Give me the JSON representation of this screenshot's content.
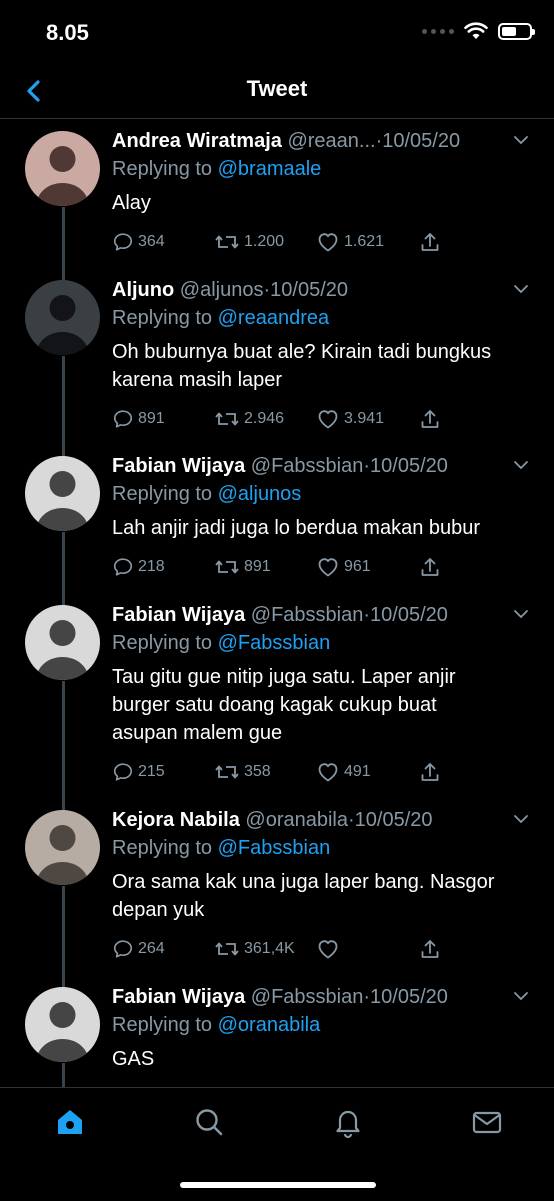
{
  "status_bar": {
    "time": "8.05",
    "battery_level": 0.55
  },
  "header": {
    "title": "Tweet"
  },
  "tweets": [
    {
      "name": "Andrea Wiratmaja",
      "handle": "@reaan...",
      "separator": "·",
      "date": "10/05/20",
      "reply_prefix": "Replying to",
      "reply_to": "@bramaale",
      "text": [
        "Alay"
      ],
      "replies": "364",
      "retweets": "1.200",
      "likes": "1.621",
      "avatar_colors": [
        "#c9a9a1",
        "#3b2622"
      ]
    },
    {
      "name": "Aljuno",
      "handle": "@aljunos",
      "separator": "·",
      "date": "10/05/20",
      "reply_prefix": "Replying to",
      "reply_to": "@reaandrea",
      "text": [
        "Oh buburnya buat ale? Kirain tadi bungkus",
        "karena masih laper"
      ],
      "replies": "891",
      "retweets": "2.946",
      "likes": "3.941",
      "avatar_colors": [
        "#3a3f44",
        "#0d0d0f"
      ]
    },
    {
      "name": "Fabian Wijaya",
      "handle": "@Fabssbian",
      "separator": "·",
      "date": "10/05/20",
      "reply_prefix": "Replying to",
      "reply_to": "@aljunos",
      "text": [
        "Lah anjir jadi juga lo berdua makan bubur"
      ],
      "replies": "218",
      "retweets": "891",
      "likes": "961",
      "avatar_colors": [
        "#d9d9d9",
        "#2a2a2a"
      ]
    },
    {
      "name": "Fabian Wijaya",
      "handle": "@Fabssbian",
      "separator": "·",
      "date": "10/05/20",
      "reply_prefix": "Replying to",
      "reply_to": "@Fabssbian",
      "text": [
        "Tau gitu gue nitip juga satu. Laper anjir",
        "burger satu doang kagak cukup buat",
        "asupan malem gue"
      ],
      "replies": "215",
      "retweets": "358",
      "likes": "491",
      "avatar_colors": [
        "#d9d9d9",
        "#2a2a2a"
      ]
    },
    {
      "name": "Kejora Nabila",
      "handle": "@oranabila",
      "separator": "·",
      "date": "10/05/20",
      "reply_prefix": "Replying to",
      "reply_to": "@Fabssbian",
      "text": [
        "Ora sama kak una juga laper bang. Nasgor",
        "depan yuk"
      ],
      "replies": "264",
      "retweets": "361,4K",
      "likes": "",
      "avatar_colors": [
        "#b7aca3",
        "#3d3530"
      ]
    },
    {
      "name": "Fabian Wijaya",
      "handle": "@Fabssbian",
      "separator": "·",
      "date": "10/05/20",
      "reply_prefix": "Replying to",
      "reply_to": "@oranabila",
      "text": [
        "GAS"
      ],
      "replies": "",
      "retweets": "",
      "likes": "",
      "avatar_colors": [
        "#d9d9d9",
        "#2a2a2a"
      ]
    }
  ],
  "tab_bar": {
    "tabs": [
      {
        "name": "home",
        "icon": "home-icon",
        "active": true
      },
      {
        "name": "search",
        "icon": "search-icon",
        "active": false
      },
      {
        "name": "notifications",
        "icon": "bell-icon",
        "active": false
      },
      {
        "name": "messages",
        "icon": "mail-icon",
        "active": false
      }
    ]
  },
  "colors": {
    "accent": "#1da1f2",
    "muted": "#8899a6",
    "background": "#000000",
    "divider": "#2f3336"
  }
}
